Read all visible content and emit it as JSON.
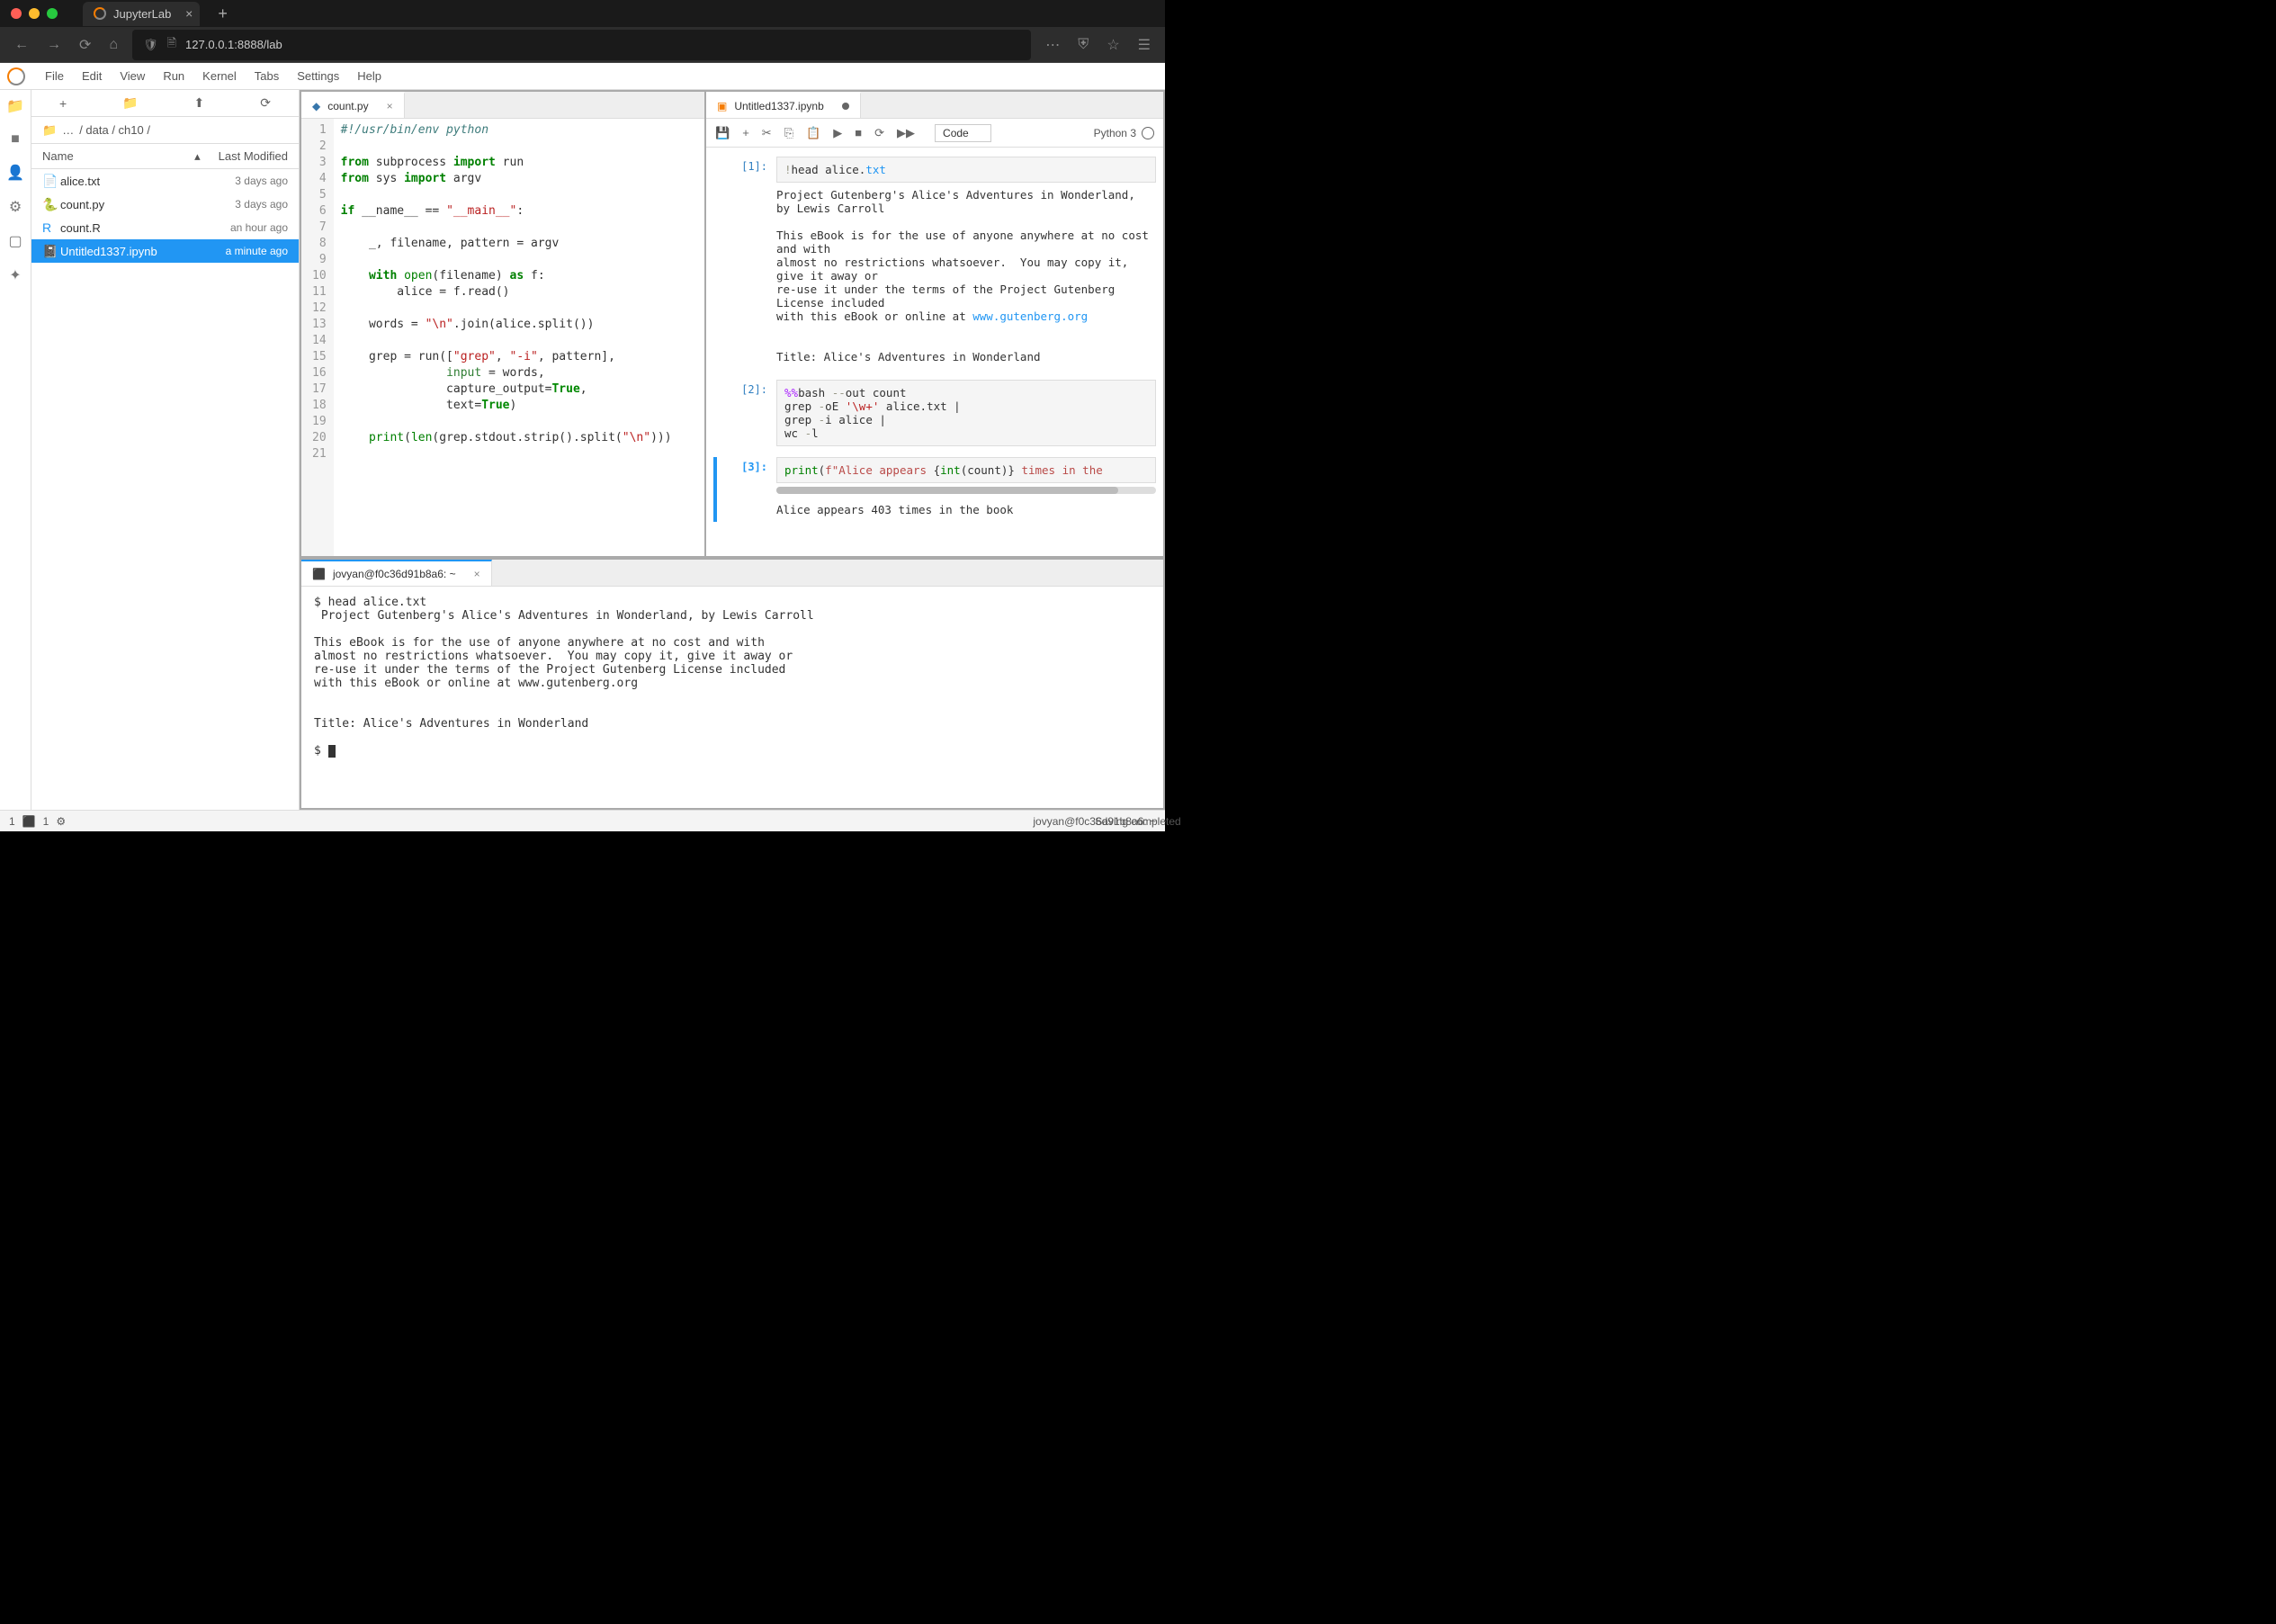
{
  "browser": {
    "tab_title": "JupyterLab",
    "url": "127.0.0.1:8888/lab"
  },
  "menubar": [
    "File",
    "Edit",
    "View",
    "Run",
    "Kernel",
    "Tabs",
    "Settings",
    "Help"
  ],
  "filepanel": {
    "crumb": "/ data / ch10 /",
    "header_name": "Name",
    "header_mod": "Last Modified",
    "items": [
      {
        "icon": "📄",
        "name": "alice.txt",
        "mod": "3 days ago",
        "color": "#555"
      },
      {
        "icon": "🐍",
        "name": "count.py",
        "mod": "3 days ago",
        "color": "#3776ab"
      },
      {
        "icon": "R",
        "name": "count.R",
        "mod": "an hour ago",
        "color": "#2196f3"
      },
      {
        "icon": "📓",
        "name": "Untitled1337.ipynb",
        "mod": "a minute ago",
        "color": "#f57c00",
        "selected": true
      }
    ]
  },
  "editor": {
    "tab_name": "count.py",
    "lines": [
      {
        "n": 1,
        "html": "<span class='c-cmt'>#!/usr/bin/env python</span>"
      },
      {
        "n": 2,
        "html": ""
      },
      {
        "n": 3,
        "html": "<span class='c-kw'>from</span> subprocess <span class='c-kw'>import</span> run"
      },
      {
        "n": 4,
        "html": "<span class='c-kw'>from</span> sys <span class='c-kw'>import</span> argv"
      },
      {
        "n": 5,
        "html": ""
      },
      {
        "n": 6,
        "html": "<span class='c-kw'>if</span> __name__ == <span class='c-str'>\"__main__\"</span>:"
      },
      {
        "n": 7,
        "html": ""
      },
      {
        "n": 8,
        "html": "    _, filename, pattern = argv"
      },
      {
        "n": 9,
        "html": ""
      },
      {
        "n": 10,
        "html": "    <span class='c-kw'>with</span> <span class='c-bltn'>open</span>(filename) <span class='c-kw'>as</span> f:"
      },
      {
        "n": 11,
        "html": "        alice = f.read()"
      },
      {
        "n": 12,
        "html": ""
      },
      {
        "n": 13,
        "html": "    words = <span class='c-str'>\"\\n\"</span>.join(alice.split())"
      },
      {
        "n": 14,
        "html": ""
      },
      {
        "n": 15,
        "html": "    grep = run([<span class='c-str'>\"grep\"</span>, <span class='c-str'>\"-i\"</span>, pattern],"
      },
      {
        "n": 16,
        "html": "               <span class='c-par'>input</span> = words,"
      },
      {
        "n": 17,
        "html": "               capture_output=<span class='c-num'>True</span>,"
      },
      {
        "n": 18,
        "html": "               text=<span class='c-num'>True</span>)"
      },
      {
        "n": 19,
        "html": ""
      },
      {
        "n": 20,
        "html": "    <span class='c-bltn'>print</span>(<span class='c-bltn'>len</span>(grep.stdout.strip().split(<span class='c-str'>\"\\n\"</span>)))"
      },
      {
        "n": 21,
        "html": ""
      }
    ]
  },
  "notebook": {
    "tab_name": "Untitled1337.ipynb",
    "cell_type": "Code",
    "kernel": "Python 3",
    "cells": [
      {
        "prompt": "[1]:",
        "input": "<span class='nb-in'>!</span>head alice.<span class='nb-blue'>txt</span>",
        "output": "Project Gutenberg's Alice's Adventures in Wonderland, by Lewis Carroll\n\nThis eBook is for the use of anyone anywhere at no cost and with\nalmost no restrictions whatsoever.  You may copy it, give it away or\nre-use it under the terms of the Project Gutenberg License included\nwith this eBook or online at <a>www.gutenberg.org</a>\n\n\nTitle: Alice's Adventures in Wonderland"
      },
      {
        "prompt": "[2]:",
        "input": "<span class='c-mag'>%%</span>bash <span class='nb-in'>--</span>out count\ngrep <span class='nb-in'>-</span>oE <span class='c-str'>'\\w+'</span> alice.txt |\ngrep <span class='nb-in'>-</span>i alice |\nwc <span class='nb-in'>-</span>l"
      },
      {
        "prompt": "[3]:",
        "input": "<span class='c-bltn'>print</span>(<span class='nb-red'>f\"Alice appears </span>{<span class='c-bltn'>int</span>(count)}<span class='nb-red'> times in the</span>",
        "output": "Alice appears 403 times in the book",
        "active": true,
        "hscroll": true
      }
    ]
  },
  "terminal": {
    "tab_name": "jovyan@f0c36d91b8a6: ~",
    "body": "$ head alice.txt\n Project Gutenberg's Alice's Adventures in Wonderland, by Lewis Carroll\n\nThis eBook is for the use of anyone anywhere at no cost and with\nalmost no restrictions whatsoever.  You may copy it, give it away or\nre-use it under the terms of the Project Gutenberg License included\nwith this eBook or online at www.gutenberg.org\n\n\nTitle: Alice's Adventures in Wonderland\n\n$ "
  },
  "statusbar": {
    "left_1": "1",
    "left_2": "1",
    "center": "Saving completed",
    "right": "jovyan@f0c36d91b8a6: ~"
  }
}
